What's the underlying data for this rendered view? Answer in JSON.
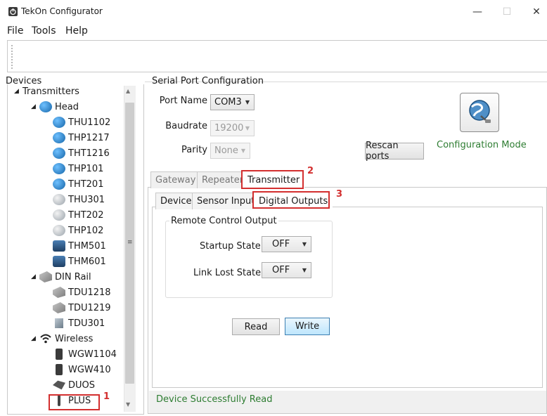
{
  "window": {
    "title": "TekOn Configurator",
    "minimize": "—",
    "maximize": "☐",
    "close": "✕"
  },
  "menu": [
    "File",
    "Tools",
    "Help"
  ],
  "devices": {
    "label": "Devices",
    "tree": {
      "transmitters": "Transmitters",
      "head": "Head",
      "head_items": [
        "THU1102",
        "THP1217",
        "THT1216",
        "THP101",
        "THT201",
        "THU301",
        "THT202",
        "THP102",
        "THM501",
        "THM601"
      ],
      "din_rail": "DIN Rail",
      "din_items": [
        "TDU1218",
        "TDU1219",
        "TDU301"
      ],
      "wireless": "Wireless",
      "wireless_items": [
        "WGW1104",
        "WGW410",
        "DUOS",
        "PLUS"
      ]
    }
  },
  "serial_port": {
    "label": "Serial Port Configuration",
    "port_name_label": "Port Name",
    "port_name_value": "COM3",
    "baudrate_label": "Baudrate",
    "baudrate_value": "19200",
    "parity_label": "Parity",
    "parity_value": "None",
    "rescan_label": "Rescan ports",
    "config_mode_label": "Configuration Mode"
  },
  "tabs": {
    "main": [
      "Gateway",
      "Repeater",
      "Transmitter"
    ],
    "sub": [
      "Device",
      "Sensor Input",
      "Digital Outputs"
    ]
  },
  "remote_control": {
    "label": "Remote Control Output",
    "startup_label": "Startup State",
    "startup_value": "OFF",
    "link_lost_label": "Link Lost State",
    "link_lost_value": "OFF"
  },
  "buttons": {
    "read": "Read",
    "write": "Write"
  },
  "status": "Device Successfully Read",
  "callouts": [
    "1",
    "2",
    "3"
  ],
  "colors": {
    "highlight": "#d32f2f",
    "status_green": "#2e7d32"
  }
}
